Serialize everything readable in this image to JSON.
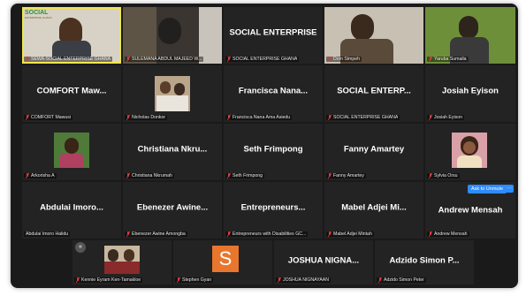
{
  "tiles": [
    {
      "id": "t0",
      "display_name": "",
      "label": "SEWA-SOCIAL ENTERPRISE GHANA",
      "muted": true,
      "logo_text": "SOCIAL",
      "logo_sub": "ENTERPRISE GHANA"
    },
    {
      "id": "t1",
      "display_name": "",
      "label": "SULEMANA ABDUL MAJEED W...",
      "muted": true
    },
    {
      "id": "t2",
      "display_name": "SOCIAL ENTERPRISE",
      "label": "SOCIAL ENTERPRISE GHANA",
      "muted": true
    },
    {
      "id": "t3",
      "display_name": "",
      "label": "Dom Simpeh",
      "muted": true
    },
    {
      "id": "t4",
      "display_name": "",
      "label": "Yaruba Sumaila",
      "muted": true
    },
    {
      "id": "t5",
      "display_name": "COMFORT Maw...",
      "label": "COMFORT Mawusi",
      "muted": true
    },
    {
      "id": "t6",
      "display_name": "",
      "label": "Nicholas Donkor",
      "muted": true
    },
    {
      "id": "t7",
      "display_name": "Francisca Nana...",
      "label": "Francisca Nana Ama Asiedu",
      "muted": true
    },
    {
      "id": "t8",
      "display_name": "SOCIAL ENTERP...",
      "label": "SOCIAL ENTERPRISE GHANA",
      "muted": true
    },
    {
      "id": "t9",
      "display_name": "Josiah Eyison",
      "label": "Josiah Eyison",
      "muted": true
    },
    {
      "id": "t10",
      "display_name": "",
      "label": "Arkorisha A",
      "muted": true
    },
    {
      "id": "t11",
      "display_name": "Christiana Nkru...",
      "label": "Christiana Nkrumah",
      "muted": true
    },
    {
      "id": "t12",
      "display_name": "Seth Frimpong",
      "label": "Seth Frimpong",
      "muted": true
    },
    {
      "id": "t13",
      "display_name": "Fanny Amartey",
      "label": "Fanny Amartey",
      "muted": true
    },
    {
      "id": "t14",
      "display_name": "",
      "label": "Sylvia Orsu",
      "muted": true
    },
    {
      "id": "t15",
      "display_name": "Abdulai Imoro...",
      "label": "Abdulai Imoro Halidu",
      "muted": false
    },
    {
      "id": "t16",
      "display_name": "Ebenezer Awine...",
      "label": "Ebenezer Awine Amongba",
      "muted": true
    },
    {
      "id": "t17",
      "display_name": "Entrepreneurs...",
      "label": "Entrepreneurs with Disabilities GC...",
      "muted": true
    },
    {
      "id": "t18",
      "display_name": "Mabel Adjei Mi...",
      "label": "Mabel Adjei Mintah",
      "muted": true
    },
    {
      "id": "t19",
      "display_name": "Andrew Mensah",
      "label": "Andrew Mensah",
      "muted": true
    },
    {
      "id": "t20",
      "display_name": "",
      "label": "Kennie Eyram Ken-Tamakloe",
      "muted": true
    },
    {
      "id": "t21",
      "display_name": "",
      "label": "Stephen Gyan",
      "muted": true,
      "avatar_letter": "S"
    },
    {
      "id": "t22",
      "display_name": "JOSHUA NIGNA...",
      "label": "JOSHUA NIGNAYAAN",
      "muted": true
    },
    {
      "id": "t23",
      "display_name": "Adzido Simon P...",
      "label": "Adzido Simon Peter",
      "muted": true
    }
  ],
  "controls": {
    "ask_to_unmute": "Ask to Unmute",
    "more": "···",
    "collapse": "«"
  },
  "colors": {
    "background": "#1a1a1a",
    "tile": "#232323",
    "active_speaker": "#f0e64a",
    "muted_icon": "#e0393e",
    "button_blue": "#2d8cff",
    "avatar_orange": "#e8762d"
  }
}
